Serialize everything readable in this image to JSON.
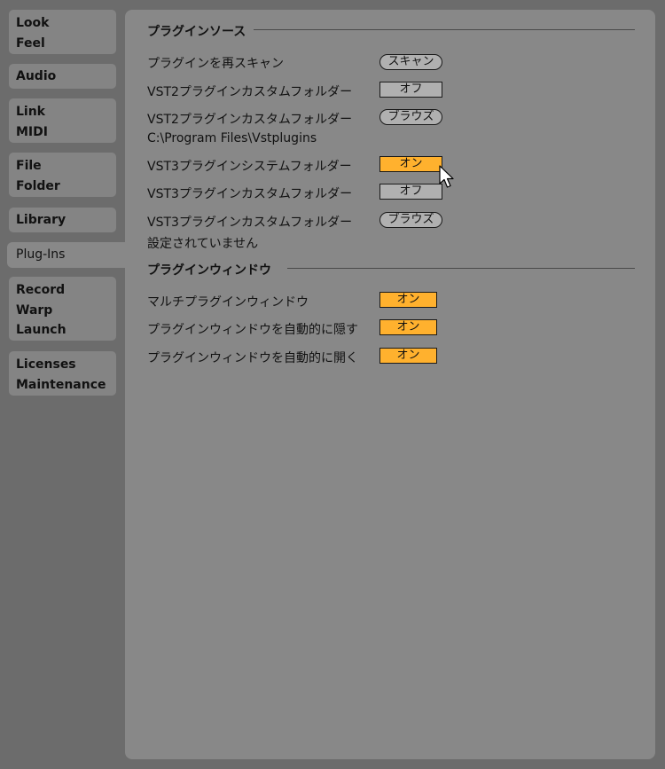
{
  "sidebar": {
    "tabs": [
      {
        "lines": [
          "Look",
          "Feel"
        ]
      },
      {
        "lines": [
          "Audio"
        ]
      },
      {
        "lines": [
          "Link",
          "MIDI"
        ]
      },
      {
        "lines": [
          "File",
          "Folder"
        ]
      },
      {
        "lines": [
          "Library"
        ]
      },
      {
        "lines": [
          "Plug-Ins"
        ]
      },
      {
        "lines": [
          "Record",
          "Warp",
          "Launch"
        ]
      },
      {
        "lines": [
          "Licenses",
          "Maintenance"
        ]
      }
    ],
    "active_tab": "Plug-Ins"
  },
  "plugin_sources": {
    "header": "プラグインソース",
    "rescan": {
      "label": "プラグインを再スキャン",
      "button": "スキャン"
    },
    "vst2_custom_toggle": {
      "label": "VST2プラグインカスタムフォルダー",
      "value": "オフ"
    },
    "vst2_custom_browse": {
      "label": "VST2プラグインカスタムフォルダー",
      "button": "ブラウズ",
      "path": "C:\\Program Files\\Vstplugins"
    },
    "vst3_system_toggle": {
      "label": "VST3プラグインシステムフォルダー",
      "value": "オン"
    },
    "vst3_custom_toggle": {
      "label": "VST3プラグインカスタムフォルダー",
      "value": "オフ"
    },
    "vst3_custom_browse": {
      "label": "VST3プラグインカスタムフォルダー",
      "button": "ブラウズ",
      "path": "設定されていません"
    }
  },
  "plugin_windows": {
    "header": "プラグインウィンドウ",
    "multi_window": {
      "label": "マルチプラグインウィンドウ",
      "value": "オン"
    },
    "auto_hide": {
      "label": "プラグインウィンドウを自動的に隠す",
      "value": "オン"
    },
    "auto_open": {
      "label": "プラグインウィンドウを自動的に開く",
      "value": "オン"
    }
  },
  "colors": {
    "on": "#ffb12e",
    "off": "#b0b0b0",
    "panel": "#888888",
    "background": "#6c6c6c"
  }
}
